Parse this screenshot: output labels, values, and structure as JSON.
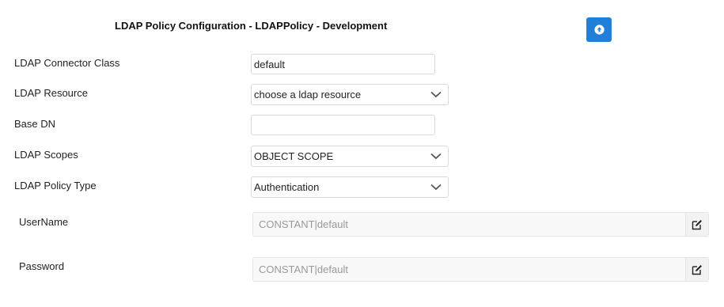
{
  "header": {
    "title": "LDAP Policy Configuration - LDAPPolicy - Development",
    "accent": "#1f7fd9"
  },
  "form": {
    "connector_class": {
      "label": "LDAP Connector Class",
      "value": "default"
    },
    "resource": {
      "label": "LDAP Resource",
      "selected": "choose a ldap resource"
    },
    "base_dn": {
      "label": "Base DN",
      "value": ""
    },
    "scopes": {
      "label": "LDAP Scopes",
      "selected": "OBJECT SCOPE"
    },
    "policy_type": {
      "label": "LDAP Policy Type",
      "selected": "Authentication"
    },
    "username": {
      "label": "UserName",
      "value": "CONSTANT|default"
    },
    "password": {
      "label": "Password",
      "value": "CONSTANT|default"
    }
  },
  "icons": {
    "upload": "arrow-up-circle-icon",
    "dropdown": "chevron-down-icon",
    "edit": "edit-icon"
  }
}
